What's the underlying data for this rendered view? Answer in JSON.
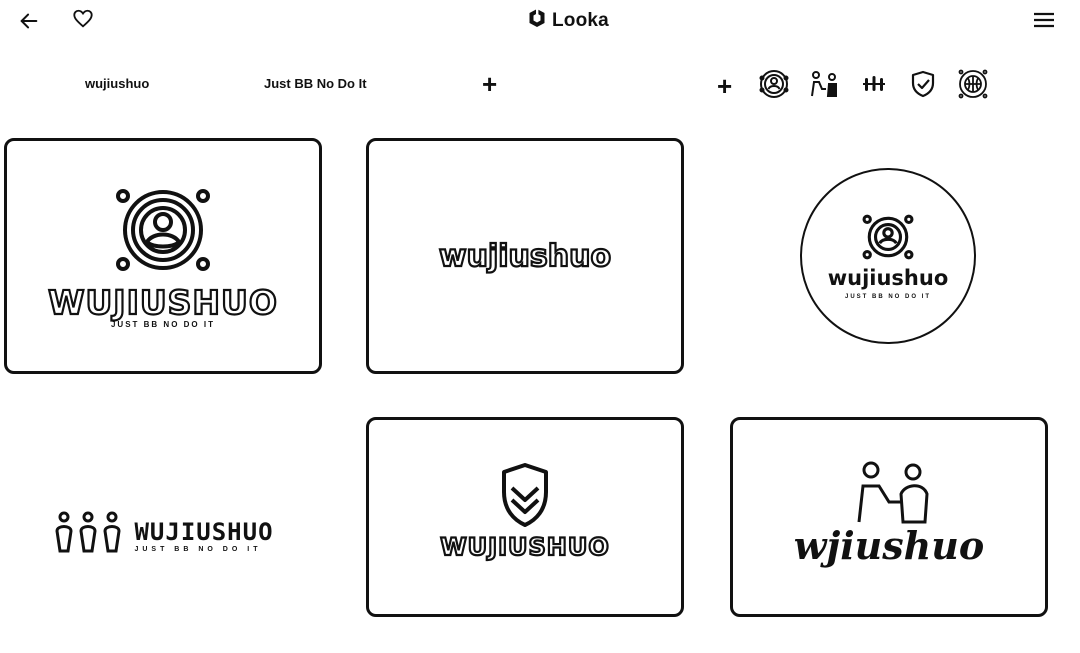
{
  "app": {
    "name": "Looka"
  },
  "filters": {
    "chips": [
      "wujiushuo",
      "Just BB No Do It"
    ],
    "icons": [
      "avatar-icon",
      "people-icon",
      "fence-icon",
      "shield-icon",
      "globe-icon"
    ]
  },
  "cards": [
    {
      "wordmark": "WUJIUSHUO",
      "tagline": "JUST BB NO DO IT",
      "icon": "avatar-ring-icon"
    },
    {
      "wordmark": "wujiushuo"
    },
    {
      "wordmark": "wujiushuo",
      "tagline": "JUST BB NO DO IT",
      "icon": "avatar-ring-icon"
    },
    {
      "wordmark": "WUJIUSHUO",
      "tagline": "JUST BB NO DO IT",
      "icon": "people-icon"
    },
    {
      "wordmark": "WUJIUSHUO",
      "icon": "shield-icon"
    },
    {
      "wordmark": "wjiushuo",
      "icon": "people-icon"
    }
  ],
  "colors": {
    "ink": "#111111",
    "background": "#ffffff"
  }
}
